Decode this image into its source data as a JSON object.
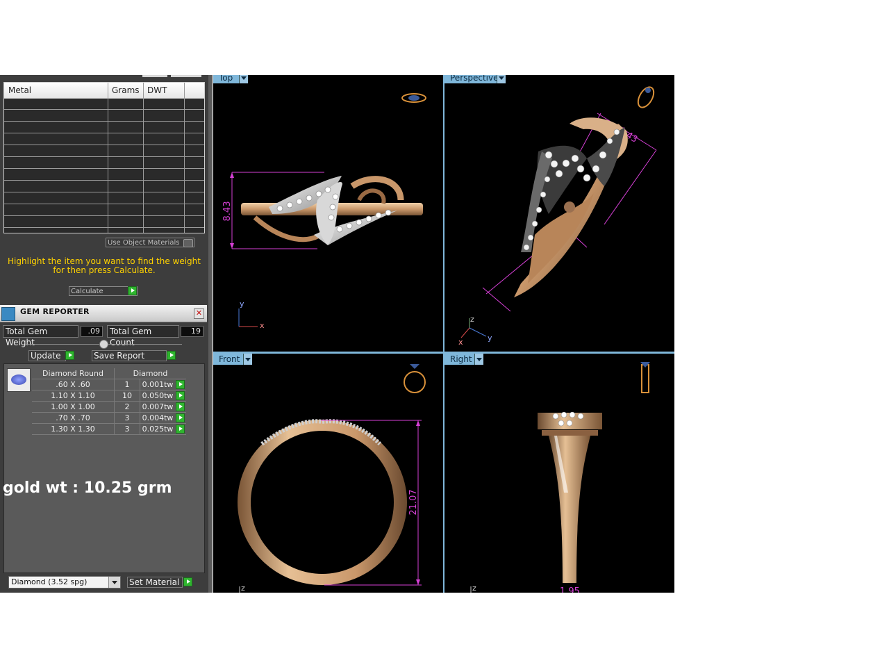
{
  "metal_report": {
    "columns": [
      "Metal",
      "Grams",
      "DWT"
    ],
    "use_object_materials": "Use Object Materials",
    "instruction_line1": "Highlight the item you want to find the weight",
    "instruction_line2": "for then press Calculate.",
    "calculate_label": "Calculate"
  },
  "gem_reporter": {
    "title": "GEM REPORTER",
    "total_weight_label": "Total Gem Weight",
    "total_weight_value": ".09",
    "total_count_label": "Total Gem Count",
    "total_count_value": "19",
    "update_label": "Update",
    "save_report_label": "Save Report",
    "table_headers": [
      "Diamond Round",
      "Diamond"
    ],
    "rows": [
      {
        "size": ".60 X .60",
        "count": "1",
        "weight": "0.001tw"
      },
      {
        "size": "1.10 X 1.10",
        "count": "10",
        "weight": "0.050tw"
      },
      {
        "size": "1.00 X 1.00",
        "count": "2",
        "weight": "0.007tw"
      },
      {
        "size": ".70 X .70",
        "count": "3",
        "weight": "0.004tw"
      },
      {
        "size": "1.30 X 1.30",
        "count": "3",
        "weight": "0.025tw"
      }
    ]
  },
  "gold_weight_text": "gold wt : 10.25 grm",
  "material": {
    "selected": "Diamond     (3.52 spg)",
    "set_material_label": "Set Material"
  },
  "viewports": {
    "top": {
      "label": "Top",
      "dimension": "8.43",
      "axis_y": "y",
      "axis_x": "x"
    },
    "perspective": {
      "label": "Perspective",
      "dimension": "8.43",
      "axis_z": "z",
      "axis_y": "y",
      "axis_x": "x"
    },
    "front": {
      "label": "Front",
      "dimension": "21.07",
      "axis_z": "z"
    },
    "right": {
      "label": "Right",
      "dimension": "1.95",
      "axis_z": "z"
    }
  },
  "colors": {
    "panel_bg": "#3d3d3d",
    "viewport_bg": "#000000",
    "viewport_label": "#7fb7da",
    "dimension": "#d640d6",
    "gold": "#c9976a",
    "instruction_text": "#ffd200",
    "green_button": "#2fb52f"
  }
}
